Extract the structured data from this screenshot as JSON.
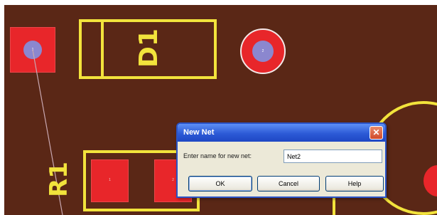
{
  "board": {
    "background": "#5a2716",
    "pad_color": "#e8262a",
    "hole_color": "#8b87cf",
    "silkscreen_color": "#f2e33c",
    "pad_square_top_left": {
      "pin": "1"
    },
    "pad_round_top": {
      "pin": "2"
    },
    "r1_pad_1": {
      "pin": "1"
    },
    "r1_pad_2": {
      "pin": "2"
    },
    "refdes_d1": "D1",
    "refdes_r1": "R1"
  },
  "dialog": {
    "title": "New Net",
    "close_glyph": "✕",
    "prompt": "Enter name for new net:",
    "input_value": "Net2",
    "ok_label": "OK",
    "cancel_label": "Cancel",
    "help_label": "Help"
  }
}
